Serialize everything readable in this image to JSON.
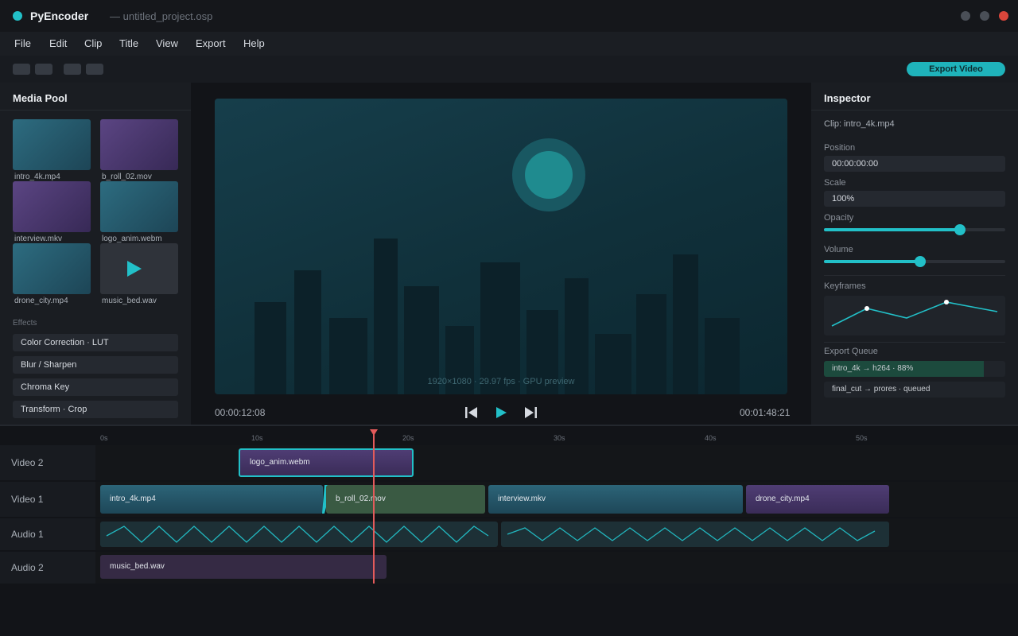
{
  "titlebar": {
    "app_name": "PyEncoder",
    "project": "— untitled_project.osp"
  },
  "menu": [
    "File",
    "Edit",
    "Clip",
    "Title",
    "View",
    "Export",
    "Help"
  ],
  "toolbar": {
    "export_label": "Export Video"
  },
  "media_pool": {
    "title": "Media Pool",
    "items": [
      {
        "name": "intro_4k.mp4",
        "style": "teal"
      },
      {
        "name": "b_roll_02.mov",
        "style": "purple"
      },
      {
        "name": "interview.mkv",
        "style": "purple"
      },
      {
        "name": "logo_anim.webm",
        "style": "teal"
      },
      {
        "name": "drone_city.mp4",
        "style": "teal"
      },
      {
        "name": "music_bed.wav",
        "style": "audio"
      }
    ],
    "effects_label": "Effects",
    "effects": [
      "Color Correction · LUT",
      "Blur / Sharpen",
      "Chroma Key",
      "Transform · Crop"
    ]
  },
  "viewer": {
    "info": "1920×1080 · 29.97 fps · GPU preview",
    "current_time": "00:00:12:08",
    "duration": "00:01:48:21"
  },
  "inspector": {
    "title": "Inspector",
    "clip": "Clip: intro_4k.mp4",
    "position_label": "Position",
    "position_value": "00:00:00:00",
    "scale_label": "Scale",
    "scale_value": "100%",
    "opacity_label": "Opacity",
    "opacity_level": 0.75,
    "volume_label": "Volume",
    "volume_level": 0.53,
    "keyframes_label": "Keyframes",
    "export_queue_label": "Export Queue",
    "queue": [
      {
        "text": "intro_4k → h264 · 88%",
        "progress": 0.88
      },
      {
        "text": "final_cut → prores · queued",
        "progress": 0
      }
    ]
  },
  "timeline": {
    "ticks": [
      "0s",
      "10s",
      "20s",
      "30s",
      "40s",
      "50s"
    ],
    "tracks": [
      "Video 2",
      "Video 1",
      "Audio 1",
      "Audio 2"
    ],
    "clips": {
      "v2": "logo_anim.webm",
      "v1": [
        "intro_4k.mp4",
        "b_roll_02.mov",
        "interview.mkv",
        "drone_city.mp4"
      ],
      "a2": "music_bed.wav"
    }
  },
  "colors": {
    "accent": "#22c0c8",
    "playhead": "#e45b5b",
    "close": "#d9463b"
  }
}
